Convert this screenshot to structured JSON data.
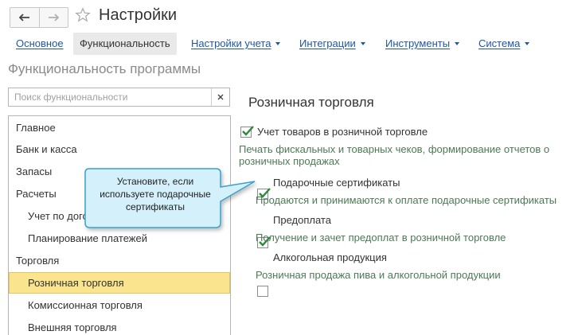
{
  "window": {
    "title": "Настройки",
    "back_icon": "arrow-left-icon",
    "forward_icon": "arrow-right-icon",
    "favorite_icon": "star-outline-icon"
  },
  "tabs": [
    {
      "label": "Основное",
      "active": false,
      "dropdown": false
    },
    {
      "label": "Функциональность",
      "active": true,
      "dropdown": false
    },
    {
      "label": "Настройки учета",
      "active": false,
      "dropdown": true
    },
    {
      "label": "Интеграции",
      "active": false,
      "dropdown": true
    },
    {
      "label": "Инструменты",
      "active": false,
      "dropdown": true
    },
    {
      "label": "Система",
      "active": false,
      "dropdown": true
    }
  ],
  "section_title": "Функциональность программы",
  "search": {
    "placeholder": "Поиск функциональности",
    "value": "",
    "clear_icon": "close-icon"
  },
  "tree": [
    {
      "label": "Главное",
      "level": 0,
      "selected": false
    },
    {
      "label": "Банк и касса",
      "level": 0,
      "selected": false
    },
    {
      "label": "Запасы",
      "level": 0,
      "selected": false
    },
    {
      "label": "Расчеты",
      "level": 0,
      "selected": false
    },
    {
      "label": "Учет по договорам",
      "level": 1,
      "selected": false
    },
    {
      "label": "Планирование платежей",
      "level": 1,
      "selected": false
    },
    {
      "label": "Торговля",
      "level": 0,
      "selected": false
    },
    {
      "label": "Розничная торговля",
      "level": 1,
      "selected": true
    },
    {
      "label": "Комиссионная торговля",
      "level": 1,
      "selected": false
    },
    {
      "label": "Внешняя торговля",
      "level": 1,
      "selected": false
    }
  ],
  "group_title": "Розничная торговля",
  "options": [
    {
      "label": "Учет товаров в розничной торговле",
      "checked": true,
      "description": "Печать фискальных и товарных чеков, формирование отчетов о розничных продажах"
    },
    {
      "label": "Подарочные сертификаты",
      "checked": true,
      "description": "Продаются и принимаются к оплате подарочные сертификаты"
    },
    {
      "label": "Предоплата",
      "checked": true,
      "description": "Получение и зачет предоплат в розничной торговле"
    },
    {
      "label": "Алкогольная продукция",
      "checked": false,
      "description": "Розничная продажа пива и алкогольной продукции"
    }
  ],
  "callout": {
    "line1": "Установите, если",
    "line2": "используете подарочные",
    "line3": "сертификаты"
  },
  "colors": {
    "link": "#1f57a6",
    "description": "#4d7a56",
    "selected_row": "#fbe48e",
    "checkmark": "#2a8a3a",
    "callout_fill": "#d4f0fa",
    "callout_border": "#3aa0cc"
  }
}
